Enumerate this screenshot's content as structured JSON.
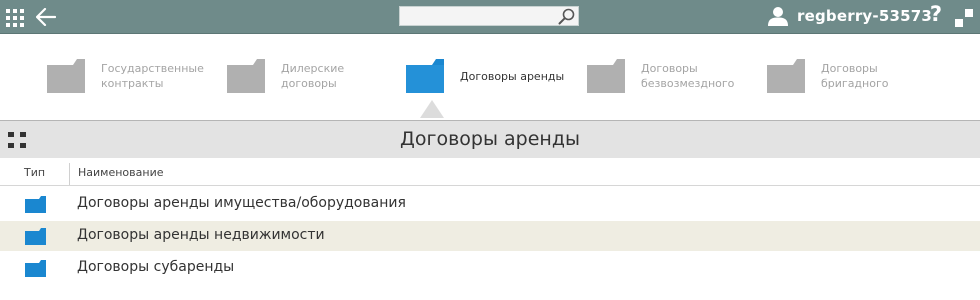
{
  "header": {
    "search": {
      "value": "",
      "placeholder": ""
    },
    "username": "regberry-53573",
    "help_label": "?"
  },
  "categories": [
    {
      "label": "Государственные\nконтракты",
      "active": false
    },
    {
      "label": "Дилерские\nдоговоры",
      "active": false
    },
    {
      "label": "Договоры аренды",
      "active": true
    },
    {
      "label": "Договоры\nбезвозмездного",
      "active": false
    },
    {
      "label": "Договоры\nбригадного",
      "active": false
    }
  ],
  "page": {
    "title": "Договоры аренды"
  },
  "table": {
    "columns": {
      "type": "Тип",
      "name": "Наименование"
    },
    "rows": [
      {
        "name": "Договоры аренды имущества/оборудования",
        "selected": false
      },
      {
        "name": "Договоры аренды недвижимости",
        "selected": true
      },
      {
        "name": "Договоры субаренды",
        "selected": false
      }
    ]
  },
  "colors": {
    "topbar": "#6f8b8a",
    "folder_active": "#1a87d0",
    "folder_inactive": "#b0b0b0",
    "selected_row": "#efede2"
  },
  "icons": [
    "apps-grid-icon",
    "back-arrow-icon",
    "search-icon",
    "user-icon",
    "help-icon",
    "expand-icon",
    "folder-icon",
    "grid-view-icon"
  ]
}
